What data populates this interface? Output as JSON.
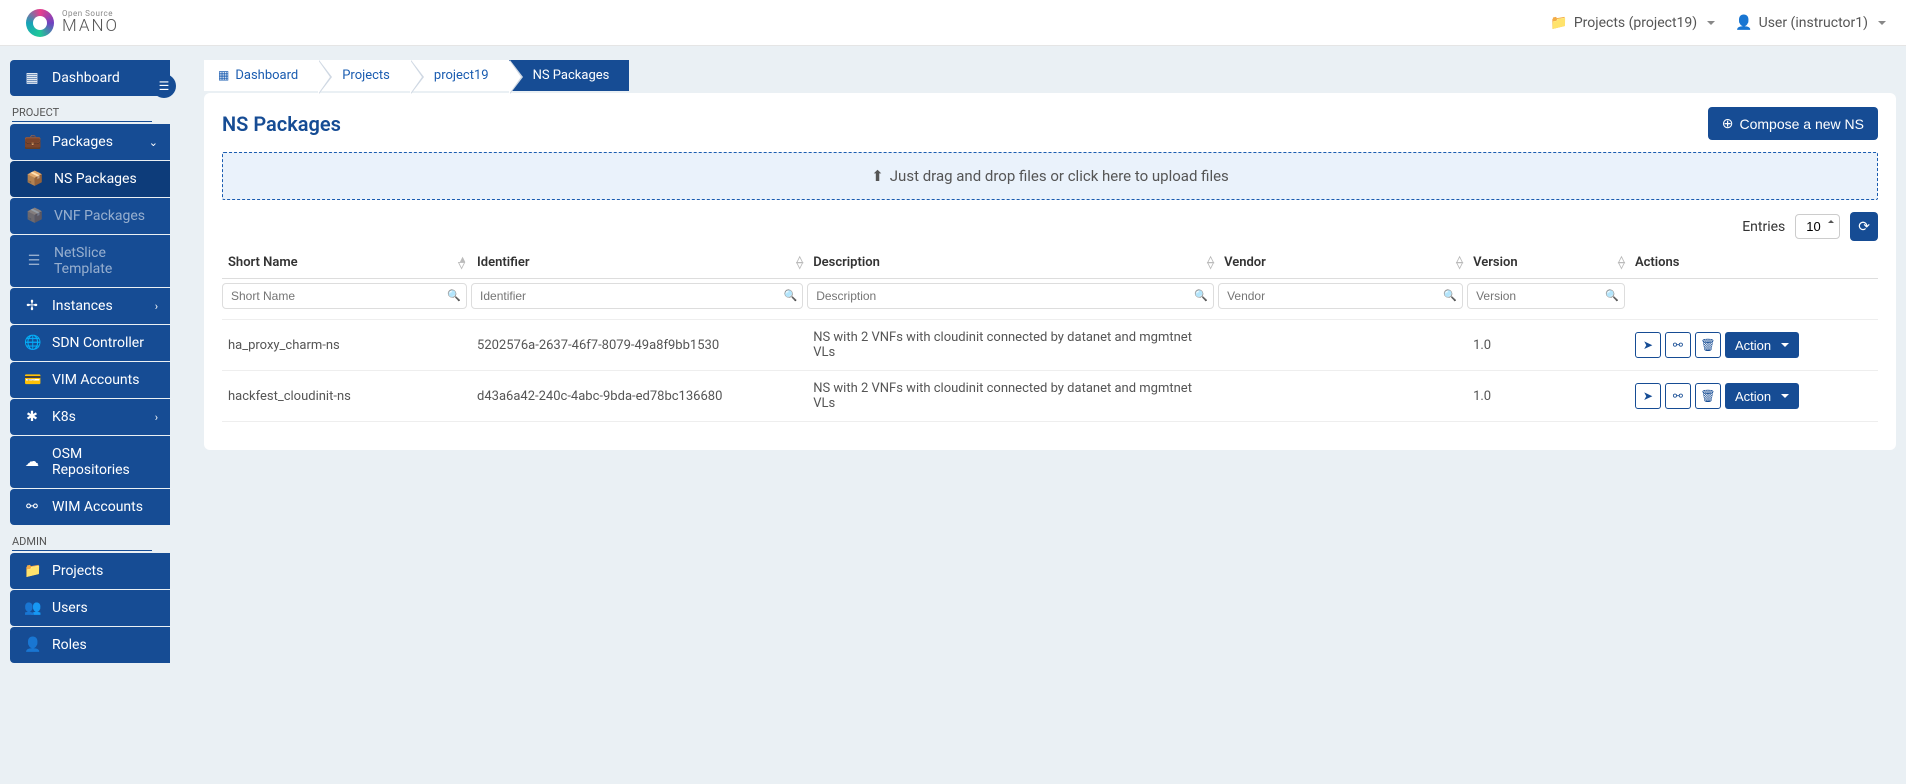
{
  "header": {
    "logo_small": "Open Source",
    "logo_big": "MANO",
    "projects_label": "Projects (project19)",
    "user_label": "User (instructor1)"
  },
  "sidebar": {
    "dashboard": "Dashboard",
    "section_project": "PROJECT",
    "section_admin": "ADMIN",
    "packages": "Packages",
    "ns_packages": "NS Packages",
    "vnf_packages": "VNF Packages",
    "netslice_template": "NetSlice Template",
    "instances": "Instances",
    "sdn_controller": "SDN Controller",
    "vim_accounts": "VIM Accounts",
    "k8s": "K8s",
    "osm_repositories": "OSM Repositories",
    "wim_accounts": "WIM Accounts",
    "projects": "Projects",
    "users": "Users",
    "roles": "Roles"
  },
  "breadcrumb": {
    "dashboard": "Dashboard",
    "projects": "Projects",
    "project": "project19",
    "current": "NS Packages"
  },
  "page": {
    "title": "NS Packages",
    "compose_button": "Compose a new NS",
    "dropzone_text": "Just drag and drop files or click here to upload files",
    "entries_label": "Entries",
    "entries_value": "10"
  },
  "table": {
    "columns": {
      "short_name": "Short Name",
      "identifier": "Identifier",
      "description": "Description",
      "vendor": "Vendor",
      "version": "Version",
      "actions": "Actions"
    },
    "placeholders": {
      "short_name": "Short Name",
      "identifier": "Identifier",
      "description": "Description",
      "vendor": "Vendor",
      "version": "Version"
    },
    "action_label": "Action",
    "rows": [
      {
        "short_name": "ha_proxy_charm-ns",
        "identifier": "5202576a-2637-46f7-8079-49a8f9bb1530",
        "description": "NS with 2 VNFs with cloudinit connected by datanet and mgmtnet VLs",
        "vendor": "",
        "version": "1.0"
      },
      {
        "short_name": "hackfest_cloudinit-ns",
        "identifier": "d43a6a42-240c-4abc-9bda-ed78bc136680",
        "description": "NS with 2 VNFs with cloudinit connected by datanet and mgmtnet VLs",
        "vendor": "",
        "version": "1.0"
      }
    ]
  }
}
